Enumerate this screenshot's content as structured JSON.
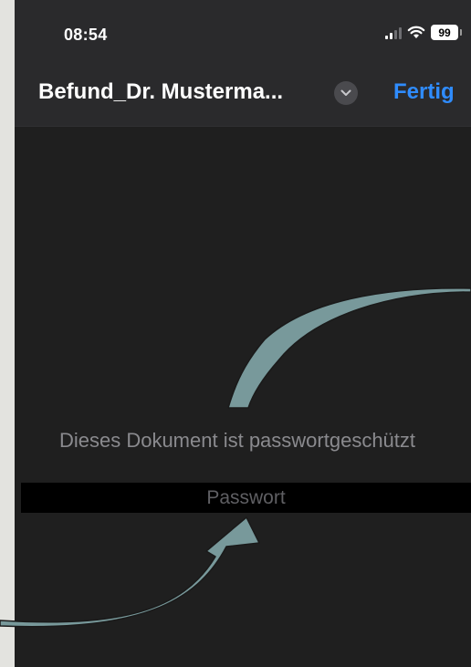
{
  "status_bar": {
    "time": "08:54",
    "battery": "99",
    "icons": [
      "signal-icon",
      "wifi-icon",
      "battery-icon"
    ]
  },
  "nav": {
    "title": "Befund_Dr. Musterma...",
    "title_chevron_icon": "chevron-down-icon",
    "done_label": "Fertig"
  },
  "content": {
    "message": "Dieses Dokument ist passwortgeschützt",
    "password_placeholder": "Passwort"
  },
  "annotations": {
    "arrow_icons": [
      "curved-arrow-icon",
      "curved-arrow-icon"
    ]
  },
  "colors": {
    "background": "#1f1f1f",
    "nav_background": "#2a2a2c",
    "accent": "#2f8cff",
    "message_text": "#8a8a8e",
    "arrow_fill": "#78999b"
  }
}
